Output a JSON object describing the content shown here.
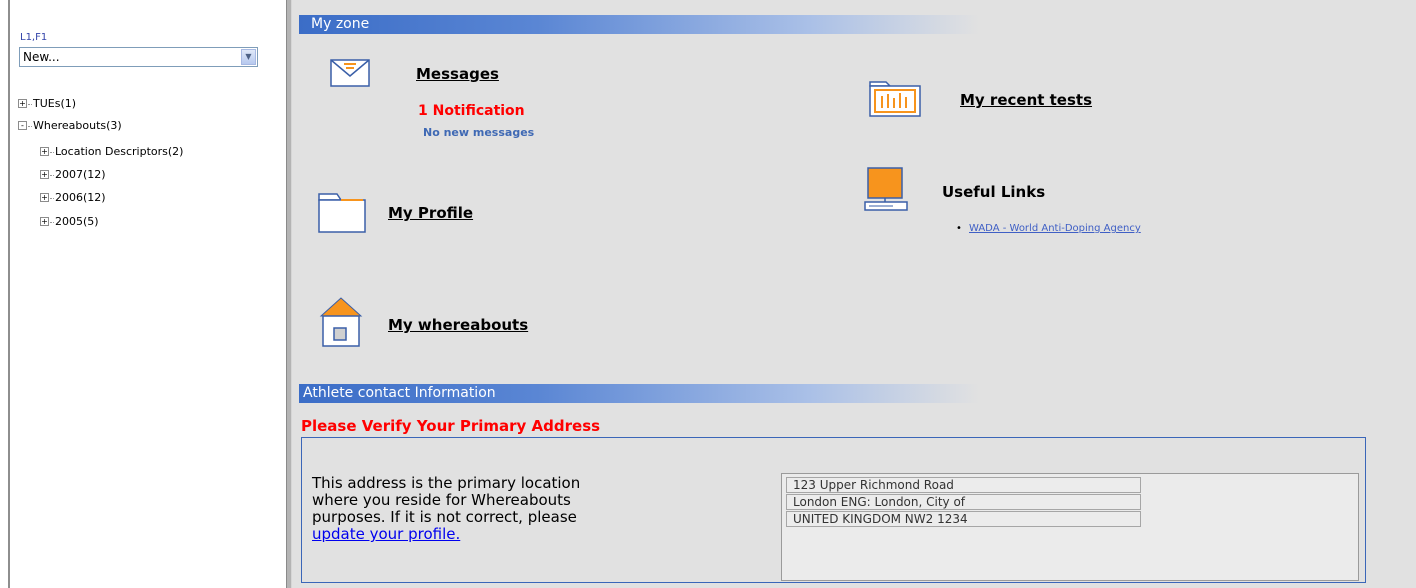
{
  "sidebar": {
    "user_label": "L1,F1",
    "new_select_value": "New...",
    "tree": [
      {
        "label": "TUEs(1)",
        "toggle": "+"
      },
      {
        "label": "Whereabouts(3)",
        "toggle": "-"
      },
      {
        "label": "Location Descriptors(2)",
        "toggle": "+"
      },
      {
        "label": "2007(12)",
        "toggle": "+"
      },
      {
        "label": "2006(12)",
        "toggle": "+"
      },
      {
        "label": "2005(5)",
        "toggle": "+"
      }
    ]
  },
  "zone": {
    "title": "My zone",
    "messages": {
      "label": "Messages",
      "notification": "1 Notification",
      "status": "No new messages",
      "icon": "envelope-icon"
    },
    "recent_tests": {
      "label": "My recent tests",
      "icon": "folder-chart-icon"
    },
    "profile": {
      "label": "My Profile",
      "icon": "folder-icon"
    },
    "useful_links": {
      "title": "Useful Links",
      "icon": "computer-icon",
      "links": [
        "WADA - World Anti-Doping Agency"
      ]
    },
    "whereabouts": {
      "label": "My whereabouts",
      "icon": "house-icon"
    }
  },
  "contact": {
    "title": "Athlete contact Information",
    "verify_title": "Please Verify Your Primary Address",
    "description_prefix": "This address is the primary location where you reside for Whereabouts purposes. If it is not correct, please ",
    "update_link": "update your profile.",
    "address_lines": [
      "123 Upper Richmond Road",
      "London  ENG: London, City of",
      "UNITED KINGDOM NW2 1234"
    ]
  },
  "colors": {
    "accent_blue": "#3b6dc7",
    "alert_red": "#ff0000",
    "icon_orange": "#f7941d",
    "main_bg": "#e1e1e1"
  }
}
